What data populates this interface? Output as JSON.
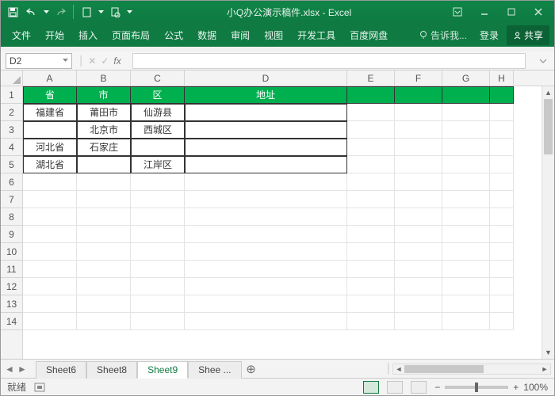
{
  "title": "小Q办公演示稿件.xlsx - Excel",
  "ribbon": {
    "file": "文件",
    "tabs": [
      "开始",
      "插入",
      "页面布局",
      "公式",
      "数据",
      "审阅",
      "视图",
      "开发工具",
      "百度网盘"
    ],
    "tell": "告诉我...",
    "signin": "登录",
    "share": "共享"
  },
  "namebox": "D2",
  "colWidths": {
    "A": 68,
    "B": 68,
    "C": 68,
    "D": 205,
    "E": 60,
    "F": 60,
    "G": 60,
    "H": 30
  },
  "colLabels": [
    "A",
    "B",
    "C",
    "D",
    "E",
    "F",
    "G",
    "H"
  ],
  "rowLabels": [
    "1",
    "2",
    "3",
    "4",
    "5",
    "6",
    "7",
    "8",
    "9",
    "10",
    "11",
    "12",
    "13",
    "14"
  ],
  "header": [
    "省",
    "市",
    "区",
    "地址"
  ],
  "data": [
    [
      "福建省",
      "莆田市",
      "仙游县",
      ""
    ],
    [
      "",
      "北京市",
      "西城区",
      ""
    ],
    [
      "河北省",
      "石家庄",
      "",
      ""
    ],
    [
      "湖北省",
      "",
      "江岸区",
      ""
    ]
  ],
  "sheets": {
    "list": [
      "Sheet6",
      "Sheet8",
      "Sheet9",
      "Shee ..."
    ],
    "active": 2
  },
  "status": {
    "ready": "就绪",
    "calc": "",
    "zoom": "100%"
  }
}
